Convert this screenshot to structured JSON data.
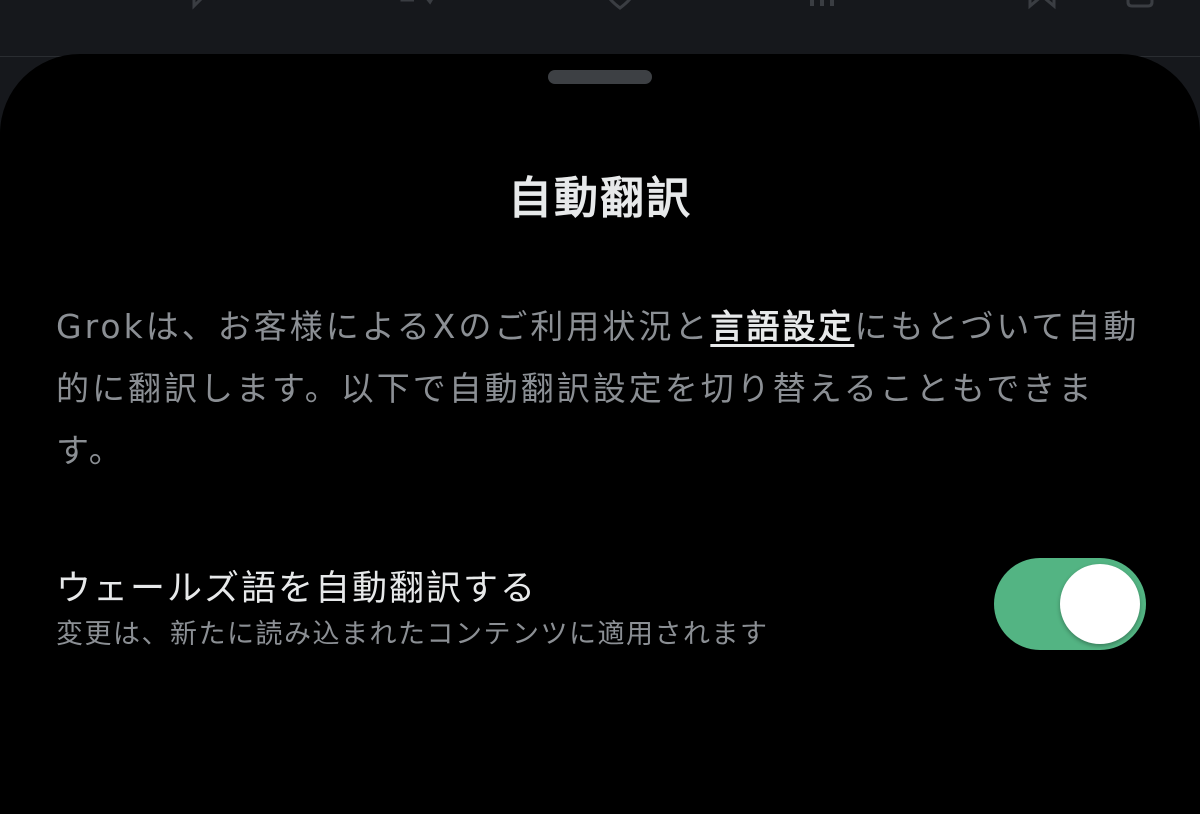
{
  "sheet": {
    "title": "自動翻訳",
    "description": {
      "before_link": "Grokは、お客様によるXのご利用状況と",
      "link": "言語設定",
      "after_link": "にもとづいて自動的に翻訳します。以下で自動翻訳設定を切り替えることもできます。"
    },
    "setting": {
      "label": "ウェールズ語を自動翻訳する",
      "sublabel": "変更は、新たに読み込まれたコンテンツに適用されます",
      "enabled": true
    }
  },
  "colors": {
    "toggle_on": "#53b483",
    "background": "#000000",
    "text_primary": "#e7e9ea",
    "text_secondary": "#8b8f94"
  },
  "icons": [
    "reply-icon",
    "repost-icon",
    "like-icon",
    "views-icon",
    "bookmark-icon",
    "share-icon",
    "sheet-grabber"
  ]
}
